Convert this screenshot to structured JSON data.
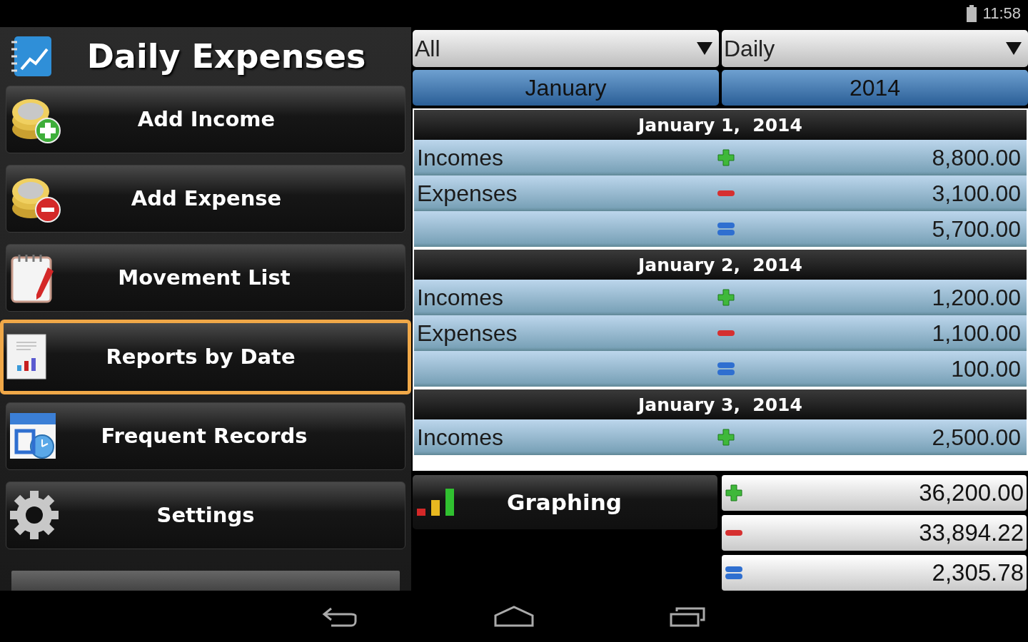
{
  "status_bar": {
    "time": "11:58"
  },
  "app": {
    "title": "Daily Expenses"
  },
  "menu": [
    {
      "label": "Add Income",
      "kind": "income",
      "selected": false
    },
    {
      "label": "Add Expense",
      "kind": "expense",
      "selected": false
    },
    {
      "label": "Movement List",
      "kind": "notepad",
      "selected": false
    },
    {
      "label": "Reports by Date",
      "kind": "report",
      "selected": true
    },
    {
      "label": "Frequent Records",
      "kind": "calendar",
      "selected": false
    },
    {
      "label": "Settings",
      "kind": "gear",
      "selected": false
    }
  ],
  "filters": [
    {
      "value": "All"
    },
    {
      "value": "Daily"
    }
  ],
  "period": [
    {
      "label": "January"
    },
    {
      "label": "2014"
    }
  ],
  "days": [
    {
      "date": "January 1,  2014",
      "rows": [
        {
          "kind": "income",
          "label": "Incomes",
          "amount": "8,800.00"
        },
        {
          "kind": "expense",
          "label": "Expenses",
          "amount": "3,100.00"
        },
        {
          "kind": "balance",
          "amount": "5,700.00"
        }
      ]
    },
    {
      "date": "January 2,  2014",
      "rows": [
        {
          "kind": "income",
          "label": "Incomes",
          "amount": "1,200.00"
        },
        {
          "kind": "expense",
          "label": "Expenses",
          "amount": "1,100.00"
        },
        {
          "kind": "balance",
          "amount": "100.00"
        }
      ]
    },
    {
      "date": "January 3,  2014",
      "rows": [
        {
          "kind": "income",
          "label": "Incomes",
          "amount": "2,500.00"
        }
      ]
    }
  ],
  "graphing_button": {
    "label": "Graphing"
  },
  "totals": [
    {
      "kind": "income",
      "amount": "36,200.00"
    },
    {
      "kind": "expense",
      "amount": "33,894.22"
    },
    {
      "kind": "balance",
      "amount": "2,305.78"
    }
  ]
}
